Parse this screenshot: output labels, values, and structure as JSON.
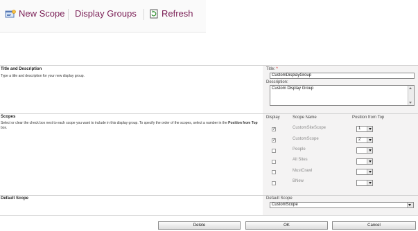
{
  "toolbar": {
    "new_scope": "New Scope",
    "display_groups": "Display Groups",
    "refresh": "Refresh"
  },
  "title_section": {
    "heading": "Title and Description",
    "description": "Type a title and description for your new display group.",
    "title_label": "Title:",
    "required_mark": "*",
    "title_value": "CustomDisplayGroup",
    "description_label": "Description:",
    "description_value": "Custom Display Group"
  },
  "scopes_section": {
    "heading": "Scopes",
    "description_pre": "Select or clear the check box next to each scope you want to include in this display group. To specify the order of the scopes, select a number in the ",
    "description_bold": "Position from Top",
    "description_post": " box.",
    "col_display": "Display",
    "col_scope_name": "Scope Name",
    "col_position": "Position from Top",
    "rows": [
      {
        "name": "CustomSiteScope",
        "checked": true,
        "position": "1"
      },
      {
        "name": "CustomScope",
        "checked": true,
        "position": "2"
      },
      {
        "name": "People",
        "checked": false,
        "position": ""
      },
      {
        "name": "All Sites",
        "checked": false,
        "position": ""
      },
      {
        "name": "MustCrawl",
        "checked": false,
        "position": ""
      },
      {
        "name": "BNew",
        "checked": false,
        "position": ""
      }
    ]
  },
  "default_section": {
    "heading": "Default Scope",
    "label": "Default Scope",
    "value": "CustomScope"
  },
  "buttons": {
    "delete": "Delete",
    "ok": "OK",
    "cancel": "Cancel"
  },
  "colors": {
    "link": "#7a1e55",
    "panel": "#f4f3f3",
    "required": "#cc0000"
  }
}
